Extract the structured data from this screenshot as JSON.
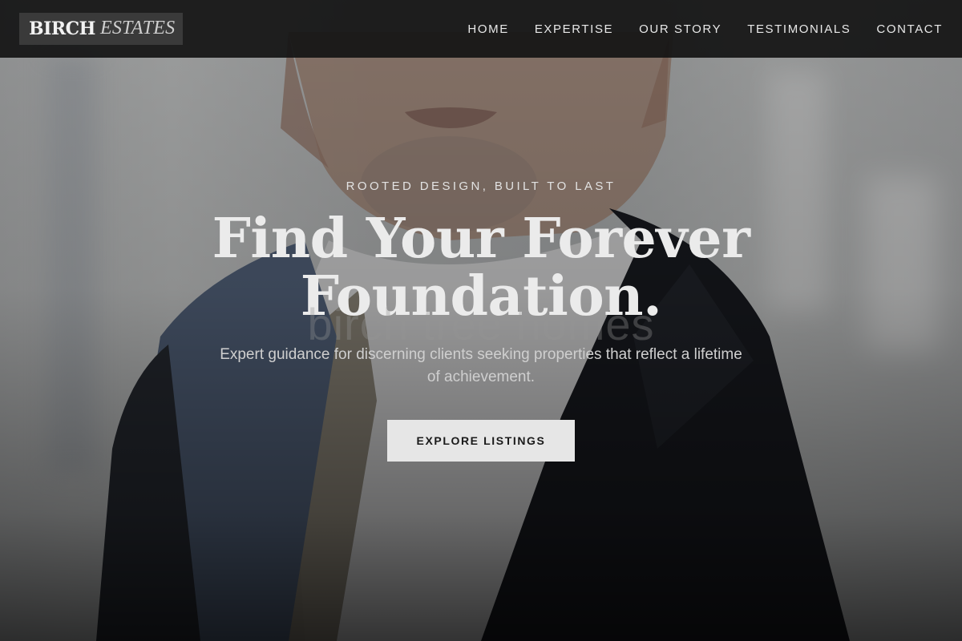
{
  "header": {
    "logo": {
      "strong": "BIRCH",
      "light": "ESTATES"
    },
    "nav": [
      {
        "label": "HOME"
      },
      {
        "label": "EXPERTISE"
      },
      {
        "label": "OUR STORY"
      },
      {
        "label": "TESTIMONIALS"
      },
      {
        "label": "CONTACT"
      }
    ]
  },
  "hero": {
    "eyebrow": "ROOTED DESIGN, BUILT TO LAST",
    "headline_line1": "Find Your Forever",
    "headline_line2": "Foundation.",
    "ghost_text": "birch tree homes",
    "subtitle": "Expert guidance for discerning clients seeking properties that reflect a lifetime of achievement.",
    "cta_label": "EXPLORE LISTINGS"
  },
  "colors": {
    "header_bg": "#141414",
    "cta_bg": "#e6e6e6",
    "cta_text": "#1a1a1a",
    "headline": "#ebebeb"
  }
}
